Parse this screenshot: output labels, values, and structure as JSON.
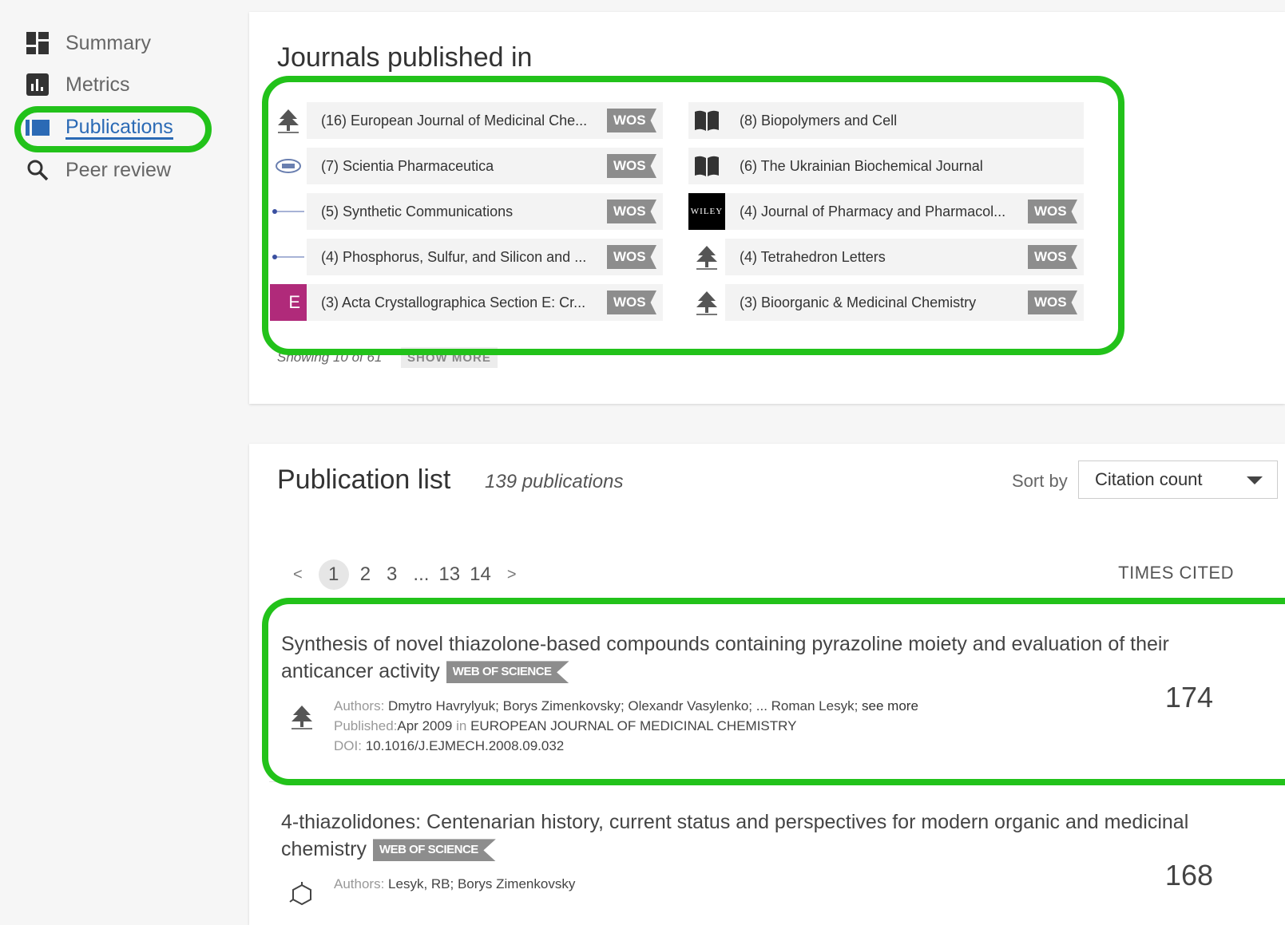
{
  "sidebar": {
    "items": [
      {
        "label": "Summary",
        "icon": "dashboard-icon"
      },
      {
        "label": "Metrics",
        "icon": "bar-chart-icon"
      },
      {
        "label": "Publications",
        "icon": "library-icon"
      },
      {
        "label": "Peer review",
        "icon": "search-icon"
      }
    ],
    "active": "Publications"
  },
  "journals": {
    "title": "Journals published in",
    "badge": "WOS",
    "items": [
      {
        "text": "(16) European Journal of Medicinal Che...",
        "wos": true,
        "logo": "elsevier-tree-logo"
      },
      {
        "text": "(8) Biopolymers and Cell",
        "wos": false,
        "logo": "open-book-icon"
      },
      {
        "text": "(7) Scientia Pharmaceutica",
        "wos": true,
        "logo": "mdpi-logo"
      },
      {
        "text": "(6) The Ukrainian Biochemical Journal",
        "wos": false,
        "logo": "open-book-icon"
      },
      {
        "text": "(5) Synthetic Communications",
        "wos": true,
        "logo": "taylor-francis-logo"
      },
      {
        "text": "(4) Journal of Pharmacy and Pharmacol...",
        "wos": true,
        "logo": "wiley-logo",
        "logo_text": "WILEY"
      },
      {
        "text": "(4) Phosphorus, Sulfur, and Silicon and ...",
        "wos": true,
        "logo": "taylor-francis-logo"
      },
      {
        "text": "(4) Tetrahedron Letters",
        "wos": true,
        "logo": "elsevier-tree-logo"
      },
      {
        "text": "(3) Acta Crystallographica Section E: Cr...",
        "wos": true,
        "logo": "iucr-e-logo",
        "logo_text": "E"
      },
      {
        "text": "(3) Bioorganic & Medicinal Chemistry",
        "wos": true,
        "logo": "elsevier-tree-logo"
      }
    ],
    "showing": "Showing 10 of 61",
    "show_more": "SHOW MORE"
  },
  "publications": {
    "title": "Publication list",
    "count": "139 publications",
    "sort_label": "Sort by",
    "sort_value": "Citation count",
    "pagination": [
      "<",
      "1",
      "2",
      "3",
      "...",
      "13",
      "14",
      ">"
    ],
    "current_page": "1",
    "times_cited_header": "TIMES CITED",
    "badge": "WEB OF SCIENCE",
    "items": [
      {
        "title": "Synthesis of novel thiazolone-based compounds containing pyrazoline moiety and evaluation of their anticancer activity",
        "authors_label": "Authors:",
        "authors": "Dmytro Havrylyuk; Borys Zimenkovsky; Olexandr Vasylenko; ... Roman Lesyk;",
        "see_more": "see more",
        "published_label": "Published:",
        "published_date": "Apr 2009",
        "in_label": "in",
        "journal": "EUROPEAN JOURNAL OF MEDICINAL CHEMISTRY",
        "doi_label": "DOI:",
        "doi": "10.1016/J.EJMECH.2008.09.032",
        "times_cited": "174",
        "logo": "elsevier-tree-logo"
      },
      {
        "title": "4-thiazolidones: Centenarian history, current status and perspectives for modern organic and medicinal chemistry",
        "authors_label": "Authors:",
        "authors": "Lesyk, RB; Borys Zimenkovsky",
        "times_cited": "168",
        "logo": "molecule-icon"
      }
    ]
  },
  "colors": {
    "highlight_green": "#22c21a",
    "active_blue": "#2b6ab5",
    "wos_gray": "#8d8d8d"
  }
}
